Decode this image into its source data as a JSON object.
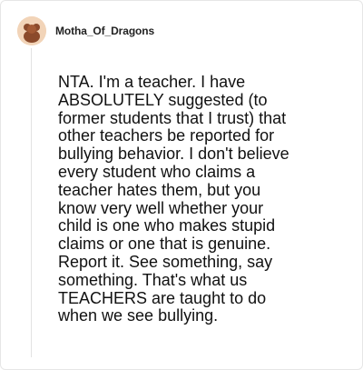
{
  "comment": {
    "author": {
      "username": "Motha_Of_Dragons",
      "avatar_icon": "avatar-icon"
    },
    "text": "NTA. I'm a teacher. I have\nABSOLUTELY suggested (to\nformer students that I trust) that\nother teachers be reported for\nbullying behavior. I don't believe\nevery student who claims a\nteacher hates them, but you\nknow very well whether your\nchild is one who makes stupid\nclaims or one that is genuine.\nReport it. See something, say\nsomething. That's what us\nTEACHERS are taught to do\nwhen we see bullying."
  },
  "colors": {
    "avatar_bg": "#f2d4b8",
    "avatar_figure": "#8b4a2b",
    "text": "#111111",
    "border": "#e6e6e6"
  }
}
